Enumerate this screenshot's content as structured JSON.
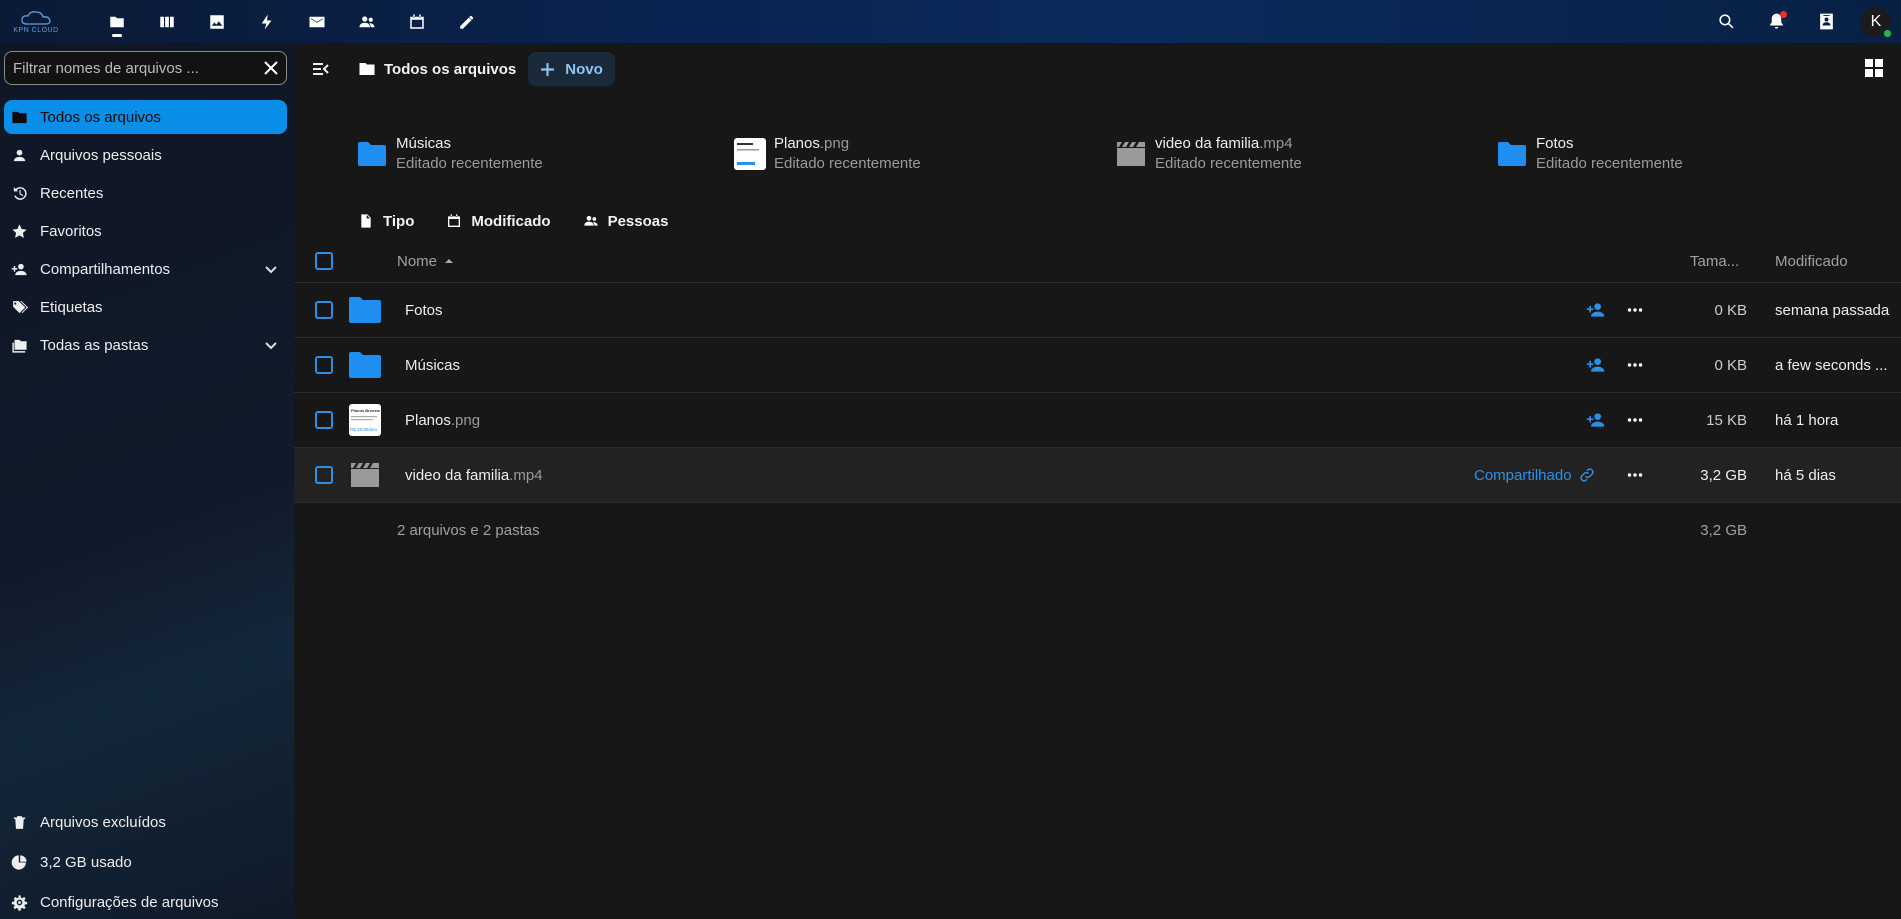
{
  "header": {
    "logo_text": "KPN CLOUD",
    "apps": [
      {
        "icon": "folder-icon",
        "name": "files"
      },
      {
        "icon": "deck-icon",
        "name": "deck"
      },
      {
        "icon": "image-icon",
        "name": "photos"
      },
      {
        "icon": "bolt-icon",
        "name": "activity"
      },
      {
        "icon": "mail-icon",
        "name": "mail"
      },
      {
        "icon": "contacts-icon",
        "name": "contacts"
      },
      {
        "icon": "calendar-icon",
        "name": "calendar"
      },
      {
        "icon": "pencil-icon",
        "name": "notes"
      }
    ],
    "avatar_initial": "K"
  },
  "sidebar": {
    "filter_placeholder": "Filtrar nomes de arquivos ...",
    "items": [
      {
        "label": "Todos os arquivos"
      },
      {
        "label": "Arquivos pessoais"
      },
      {
        "label": "Recentes"
      },
      {
        "label": "Favoritos"
      },
      {
        "label": "Compartilhamentos"
      },
      {
        "label": "Etiquetas"
      },
      {
        "label": "Todas as pastas"
      }
    ],
    "bottom": [
      {
        "label": "Arquivos excluídos"
      },
      {
        "label": "3,2 GB usado"
      },
      {
        "label": "Configurações de arquivos"
      }
    ]
  },
  "toolbar": {
    "breadcrumb": "Todos os arquivos",
    "new_label": "Novo"
  },
  "recent": [
    {
      "name": "Músicas",
      "ext": "",
      "sub": "Editado recentemente",
      "type": "folder"
    },
    {
      "name": "Planos",
      "ext": ".png",
      "sub": "Editado recentemente",
      "type": "image"
    },
    {
      "name": "video da familia",
      "ext": ".mp4",
      "sub": "Editado recentemente",
      "type": "video"
    },
    {
      "name": "Fotos",
      "ext": "",
      "sub": "Editado recentemente",
      "type": "folder"
    }
  ],
  "filters": {
    "type": "Tipo",
    "modified": "Modificado",
    "people": "Pessoas"
  },
  "table": {
    "col_name": "Nome",
    "col_size": "Tama...",
    "col_modified": "Modificado",
    "rows": [
      {
        "name": "Fotos",
        "ext": "",
        "size": "0 KB",
        "modified": "semana passada",
        "type": "folder"
      },
      {
        "name": "Músicas",
        "ext": "",
        "size": "0 KB",
        "modified": "a few seconds ...",
        "type": "folder"
      },
      {
        "name": "Planos",
        "ext": ".png",
        "size": "15 KB",
        "modified": "há 1 hora",
        "type": "image"
      },
      {
        "name": "video da familia",
        "ext": ".mp4",
        "size": "3,2 GB",
        "modified": "há 5 dias",
        "type": "video",
        "shared_label": "Compartilhado"
      }
    ],
    "summary": "2 arquivos e 2 pastas",
    "total_size": "3,2 GB"
  },
  "thumb_text": {
    "title": "Planos Brenzia",
    "price": "R$ 49,90/ano"
  },
  "colors": {
    "accent": "#0a8fe8",
    "link": "#2d8fe8",
    "folder": "#1e8ef0"
  }
}
